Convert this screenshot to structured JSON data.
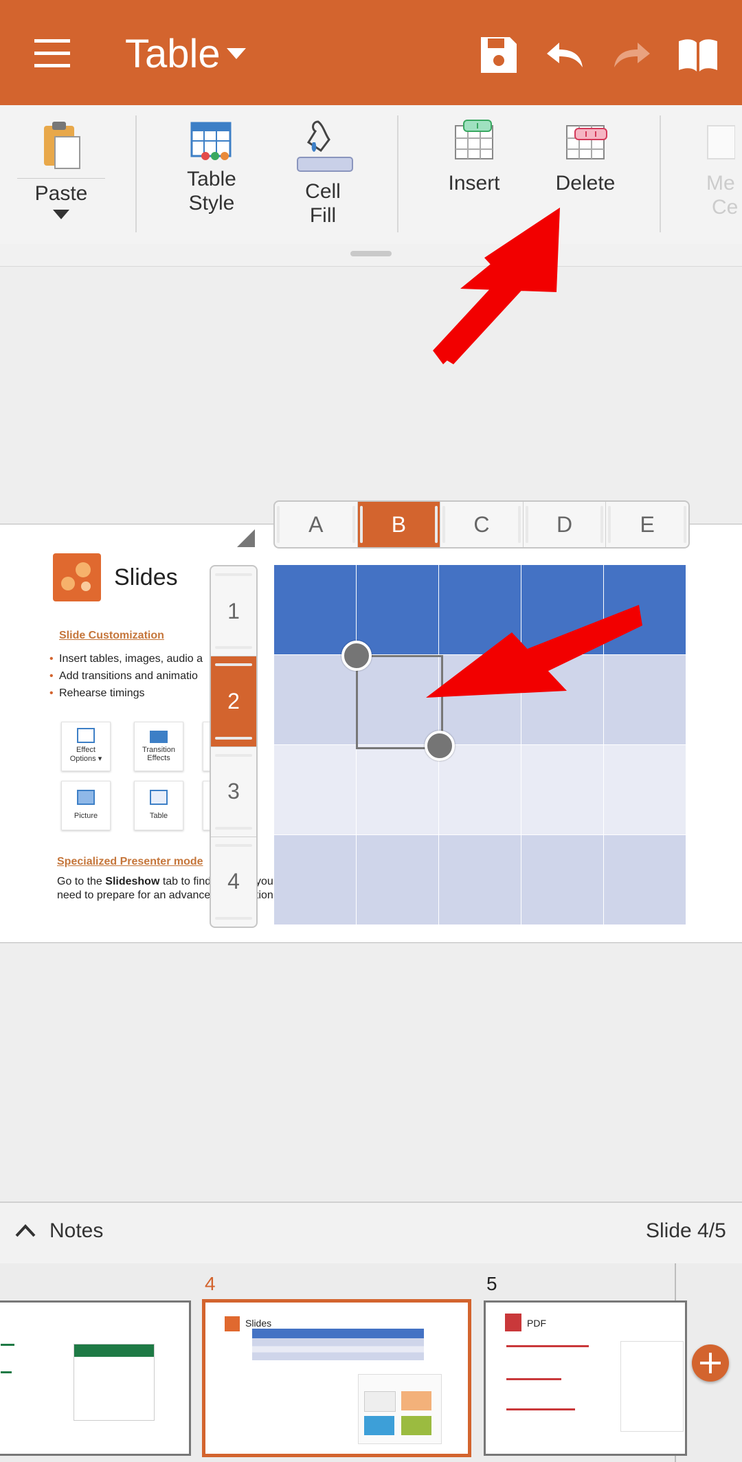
{
  "toolbar": {
    "title": "Table",
    "icons": {
      "menu": "menu-icon",
      "save": "save-icon",
      "undo": "undo-icon",
      "redo": "redo-icon",
      "reader": "book-icon"
    }
  },
  "ribbon": {
    "paste": "Paste",
    "table_style_1": "Table",
    "table_style_2": "Style",
    "cell_fill_1": "Cell",
    "cell_fill_2": "Fill",
    "insert": "Insert",
    "delete": "Delete",
    "merge_1": "Me",
    "merge_2": "Ce"
  },
  "slide": {
    "brand": "Slides",
    "section1_heading": "Slide Customization",
    "bullets": [
      "Insert tables, images, audio a",
      "Add transitions and animatio",
      "Rehearse timings"
    ],
    "cards": [
      {
        "label1": "Effect",
        "label2": "Options ▾"
      },
      {
        "label1": "Transition",
        "label2": "Effects"
      },
      {
        "label1": "Picture",
        "label2": ""
      },
      {
        "label1": "Table",
        "label2": ""
      }
    ],
    "section2_heading": "Specialized Presenter mode",
    "para_line1_pre": "Go to the ",
    "para_line1_bold": "Slideshow",
    "para_line1_post": " tab to find e",
    "para_line1_tail": "you",
    "para_line2": "need to prepare for an advanced",
    "para_line2_tail": "tion"
  },
  "table": {
    "columns": [
      "A",
      "B",
      "C",
      "D",
      "E"
    ],
    "rows": [
      "1",
      "2",
      "3",
      "4"
    ],
    "selected_column": "B",
    "selected_row": "2",
    "colors": {
      "header": "#4472c4",
      "band": "#cfd5ea",
      "light": "#e9ebf5",
      "accent": "#d3642e"
    }
  },
  "notes": {
    "label": "Notes",
    "slide_counter": "Slide 4/5"
  },
  "thumbnails": [
    {
      "number": "",
      "title": ""
    },
    {
      "number": "4",
      "title": "Slides"
    },
    {
      "number": "5",
      "title": "PDF"
    }
  ]
}
